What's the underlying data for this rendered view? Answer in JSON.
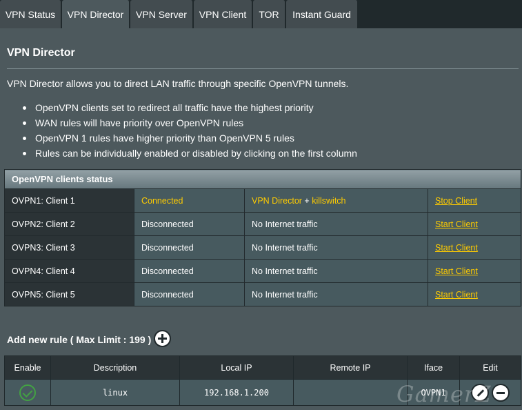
{
  "tabs": [
    {
      "label": "VPN Status",
      "active": false
    },
    {
      "label": "VPN Director",
      "active": true
    },
    {
      "label": "VPN Server",
      "active": false
    },
    {
      "label": "VPN Client",
      "active": false
    },
    {
      "label": "TOR",
      "active": false
    },
    {
      "label": "Instant Guard",
      "active": false
    }
  ],
  "page": {
    "title": "VPN Director",
    "intro": "VPN Director allows you to direct LAN traffic through specific OpenVPN tunnels.",
    "bullets": [
      "OpenVPN clients set to redirect all traffic have the highest priority",
      "WAN rules will have priority over OpenVPN rules",
      "OpenVPN 1 rules have higher priority than OpenVPN 5 rules",
      "Rules can be individually enabled or disabled by clicking on the first column"
    ]
  },
  "status_table": {
    "header": "OpenVPN clients status",
    "rows": [
      {
        "client": "OVPN1: Client 1",
        "state": "Connected",
        "traffic": "VPN Director",
        "traffic_sep": " + ",
        "traffic_extra": "killswitch",
        "action": "Stop Client"
      },
      {
        "client": "OVPN2: Client 2",
        "state": "Disconnected",
        "traffic": "No Internet traffic",
        "action": "Start Client"
      },
      {
        "client": "OVPN3: Client 3",
        "state": "Disconnected",
        "traffic": "No Internet traffic",
        "action": "Start Client"
      },
      {
        "client": "OVPN4: Client 4",
        "state": "Disconnected",
        "traffic": "No Internet traffic",
        "action": "Start Client"
      },
      {
        "client": "OVPN5: Client 5",
        "state": "Disconnected",
        "traffic": "No Internet traffic",
        "action": "Start Client"
      }
    ]
  },
  "add_rule": {
    "label": "Add new rule ( Max Limit : 199 )",
    "icon": "plus-circle-icon"
  },
  "rules_table": {
    "columns": [
      "Enable",
      "Description",
      "Local IP",
      "Remote IP",
      "Iface",
      "Edit"
    ],
    "rows": [
      {
        "enabled": true,
        "description": "linux",
        "local_ip": "192.168.1.200",
        "remote_ip": "",
        "iface": "OVPN1"
      }
    ]
  },
  "watermark": "GamerZ",
  "colors": {
    "background": "#4d595d",
    "tab_bar": "#20292c",
    "accent_yellow": "#ffcc00",
    "enabled_green": "#43a243"
  }
}
